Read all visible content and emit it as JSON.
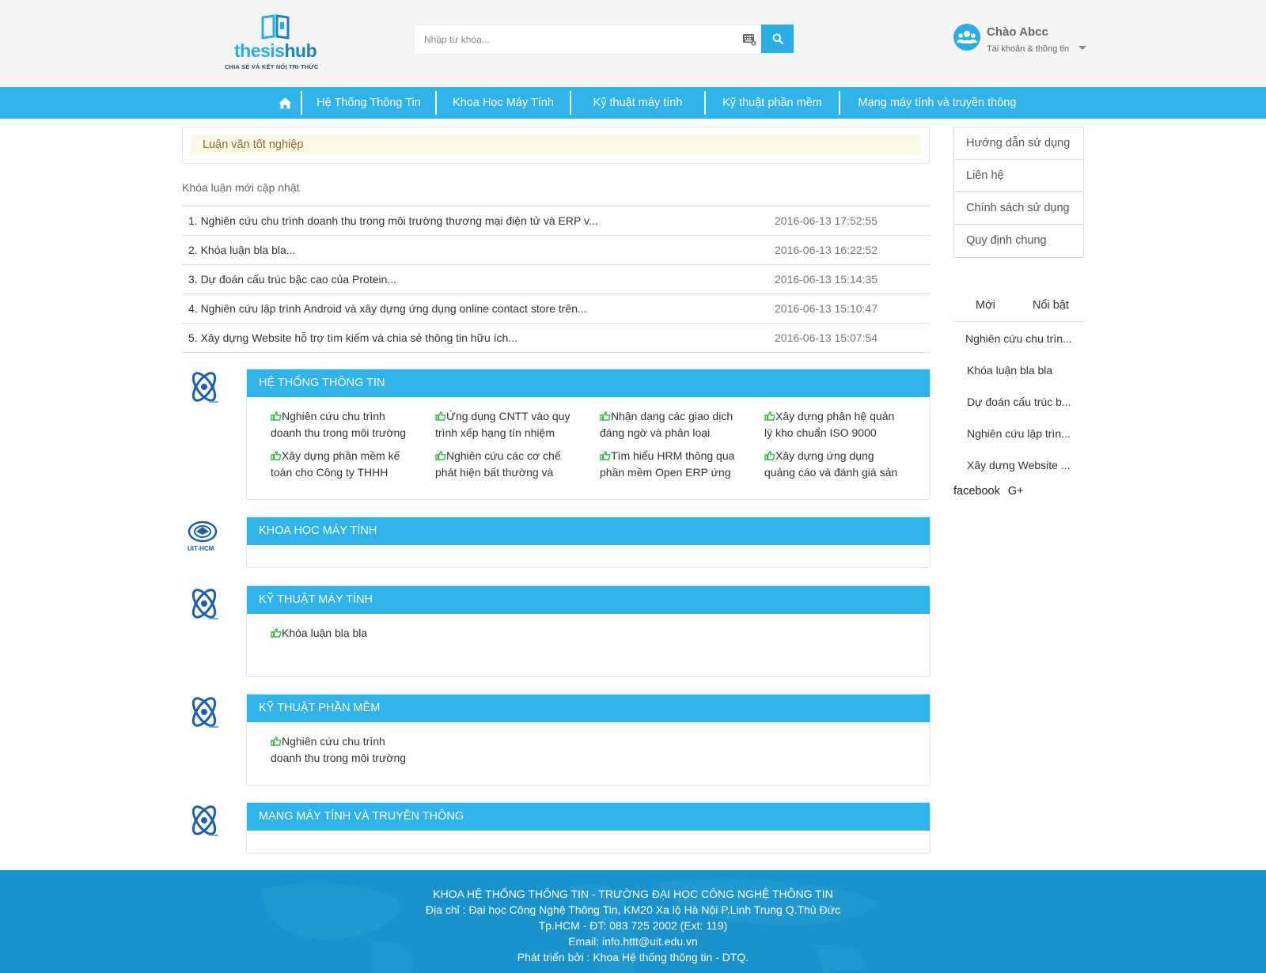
{
  "logo": {
    "text_part1": "thesis",
    "text_part2": "hub",
    "tagline": "CHIA SẺ VÀ KẾT NỐI TRI THỨC"
  },
  "search": {
    "placeholder": "Nhập từ khóa...",
    "value": "",
    "button_icon": "search-icon",
    "keyboard_icon": "keyboard-icon"
  },
  "user": {
    "greeting": "Chào Abcc",
    "submenu": "Tài khoản & thông tin",
    "avatar_icon": "users-icon"
  },
  "nav": {
    "home_icon": "home-icon",
    "items": [
      {
        "label": "Hệ Thống Thông Tin"
      },
      {
        "label": "Khoa Học Máy Tính"
      },
      {
        "label": "Kỹ thuật máy tính"
      },
      {
        "label": "Kỹ thuật phần mềm"
      },
      {
        "label": "Mạng máy tính và truyền thông"
      }
    ]
  },
  "breadcrumb": {
    "label": "Luận văn tốt nghiệp"
  },
  "recent": {
    "title": "Khóa luận mới cập nhật",
    "items": [
      {
        "title": "1. Nghiên cứu chu trình doanh thu trong môi trường thương mại điện tử và ERP v...",
        "date": "2016-06-13 17:52:55"
      },
      {
        "title": "2. Khóa luận bla bla...",
        "date": "2016-06-13 16:22:52"
      },
      {
        "title": "3. Dự đoán cấu trúc bậc cao của Protein...",
        "date": "2016-06-13 15:14:35"
      },
      {
        "title": "4. Nghiên cứu lập trình Android và xây dựng ứng dụng online contact store trên...",
        "date": "2016-06-13 15:10:47"
      },
      {
        "title": "5. Xây dựng Website hỗ trợ tìm kiếm và chia sẻ thông tin hữu ích...",
        "date": "2016-06-13 15:07:54"
      }
    ]
  },
  "categories": [
    {
      "title": "HỆ THỐNG THÔNG TIN",
      "icon": "department-logo-icon",
      "items": [
        {
          "line1": "Nghiên cứu chu trình",
          "line2": "doanh thu trong môi trường"
        },
        {
          "line1": "Ứng dụng CNTT vào quy",
          "line2": "trình xếp hạng tín nhiệm"
        },
        {
          "line1": "Nhận dạng các giao dịch",
          "line2": "đáng ngờ và phân loại"
        },
        {
          "line1": "Xây dựng phân hệ quản",
          "line2": "lý kho chuẩn ISO 9000"
        },
        {
          "line1": "Xây dựng phần mềm kế",
          "line2": "toán cho Công ty THHH"
        },
        {
          "line1": "Nghiên cứu các cơ chế",
          "line2": "phát hiện bất thường và"
        },
        {
          "line1": "Tìm hiểu HRM thông qua",
          "line2": "phần mềm Open ERP ứng"
        },
        {
          "line1": "Xây dựng ứng dụng",
          "line2": "quảng cáo và đánh giá sản"
        }
      ]
    },
    {
      "title": "KHOA HỌC MÁY TÍNH",
      "icon": "uit-hcm-logo-icon",
      "logo_text": "UIT-HCM",
      "items": []
    },
    {
      "title": "KỸ THUẬT MÁY TÍNH",
      "icon": "department-logo-icon",
      "items": [
        {
          "line1": "Khóa luận bla bla",
          "line2": ""
        }
      ]
    },
    {
      "title": "KỸ THUẬT PHẦN MỀM",
      "icon": "department-logo-icon",
      "items": [
        {
          "line1": "Nghiên cứu chu trình",
          "line2": "doanh thu trong môi trường"
        }
      ]
    },
    {
      "title": "MẠNG MÁY TÍNH VÀ TRUYỀN THÔNG",
      "icon": "department-logo-icon",
      "items": []
    }
  ],
  "sidebar": {
    "menu": [
      {
        "label": "Hướng dẫn sử dụng"
      },
      {
        "label": "Liên hệ"
      },
      {
        "label": "Chính sách sử dụng"
      },
      {
        "label": "Quy định chung"
      }
    ],
    "tabs": [
      {
        "label": "Mới"
      },
      {
        "label": "Nổi bật"
      }
    ],
    "links": [
      {
        "label": "Nghiên cứu chu trìn..."
      },
      {
        "label": "Khóa luận bla bla"
      },
      {
        "label": "Dự đoán cấu trúc b..."
      },
      {
        "label": "Nghiên cứu lập trìn..."
      },
      {
        "label": "Xây dựng Website ..."
      }
    ],
    "social": {
      "facebook": "facebook",
      "gplus": "G+"
    }
  },
  "footer": {
    "lines": [
      "KHOA HỆ THỐNG THÔNG TIN - TRƯỜNG ĐẠI HỌC CÔNG NGHỆ THÔNG TIN",
      "Địa chỉ : Đại học Công Nghệ Thông Tin, KM20 Xa lộ Hà Nội P.Linh Trung Q.Thủ Đức",
      "Tp.HCM - ĐT: 083 725 2002 (Ext: 119)",
      "Email: info.httt@uit.edu.vn",
      "Phát triển bởi : Khoa Hệ thống thông tin - DTQ."
    ]
  },
  "colors": {
    "accent": "#2fb3e8",
    "footer": "#1a93cd",
    "thumb_icon": "#3cb54a",
    "breadcrumb_bg": "#fcf8e3"
  }
}
